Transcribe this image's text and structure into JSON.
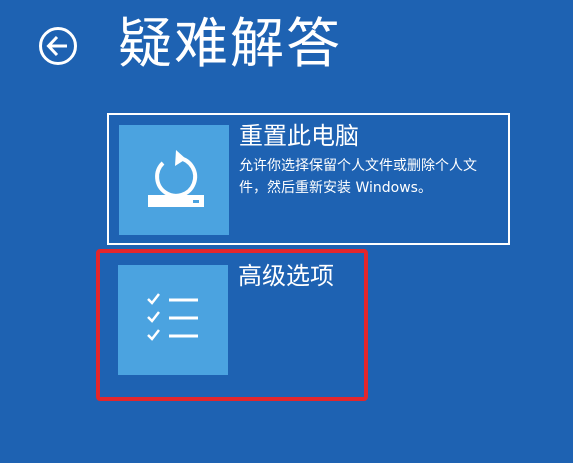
{
  "header": {
    "title": "疑难解答",
    "back_icon": "back-arrow-circle-icon"
  },
  "options": [
    {
      "title": "重置此电脑",
      "description": "允许你选择保留个人文件或删除个人文件，然后重新安装 Windows。",
      "icon": "reset-pc-icon"
    },
    {
      "title": "高级选项",
      "description": "",
      "icon": "checklist-icon"
    }
  ],
  "colors": {
    "background": "#1e62b2",
    "tile": "#4ba3e0",
    "text": "#ffffff",
    "highlight": "#e3262b"
  }
}
